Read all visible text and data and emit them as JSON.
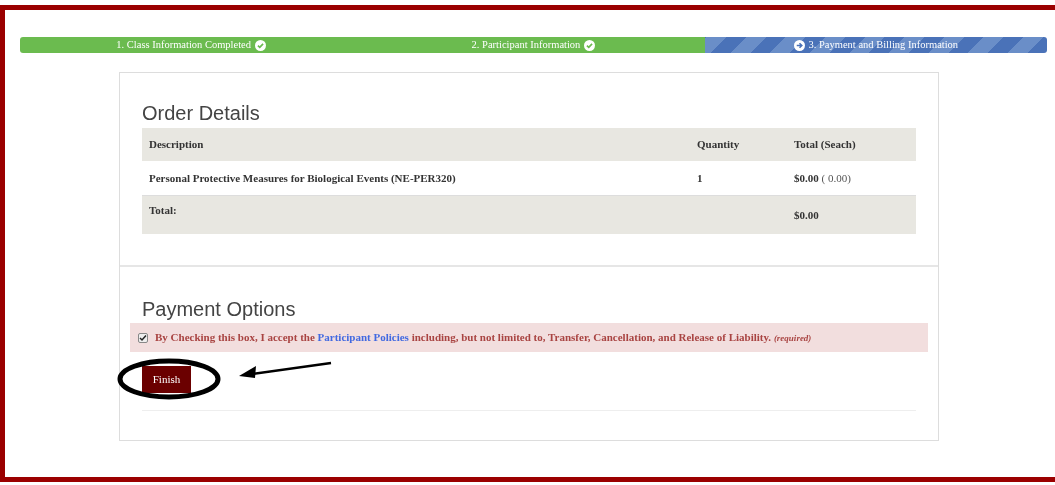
{
  "progress_steps": [
    {
      "label": "1. Class Information Completed",
      "kind": "completed"
    },
    {
      "label": "2. Participant Information",
      "kind": "completed"
    },
    {
      "label": "3. Payment and Billing Information",
      "kind": "current"
    }
  ],
  "order_details": {
    "title": "Order Details",
    "columns": [
      "Description",
      "Quantity",
      "Total (Seach)"
    ],
    "rows": [
      {
        "description": "Personal Protective Measures for Biological Events (NE-PER320)",
        "quantity": "1",
        "total": "$0.00",
        "total_note": "( 0.00)"
      }
    ],
    "total_label": "Total:",
    "total_value": "$0.00"
  },
  "payment_options": {
    "title": "Payment Options",
    "agreement": {
      "checked": true,
      "text_before": "By Checking this box, I accept the",
      "link": "Participant Policies",
      "text_after": "including, but not limited to, Transfer, Cancellation, and Release of Liability.",
      "note": "(required)"
    },
    "finish_button": "Finish"
  }
}
